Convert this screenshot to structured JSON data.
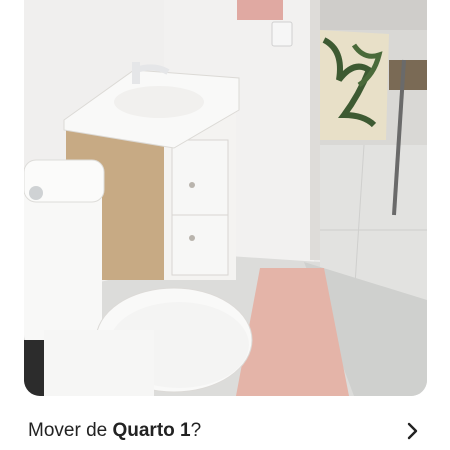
{
  "photo": {
    "subject": "bathroom-photo"
  },
  "move_row": {
    "prefix": "Mover de ",
    "room_name": "Quarto 1",
    "suffix": "?",
    "chevron_icon": "chevron-right-icon"
  },
  "colors": {
    "text": "#222222",
    "background": "#ffffff",
    "rug": "#e4b4a8"
  }
}
